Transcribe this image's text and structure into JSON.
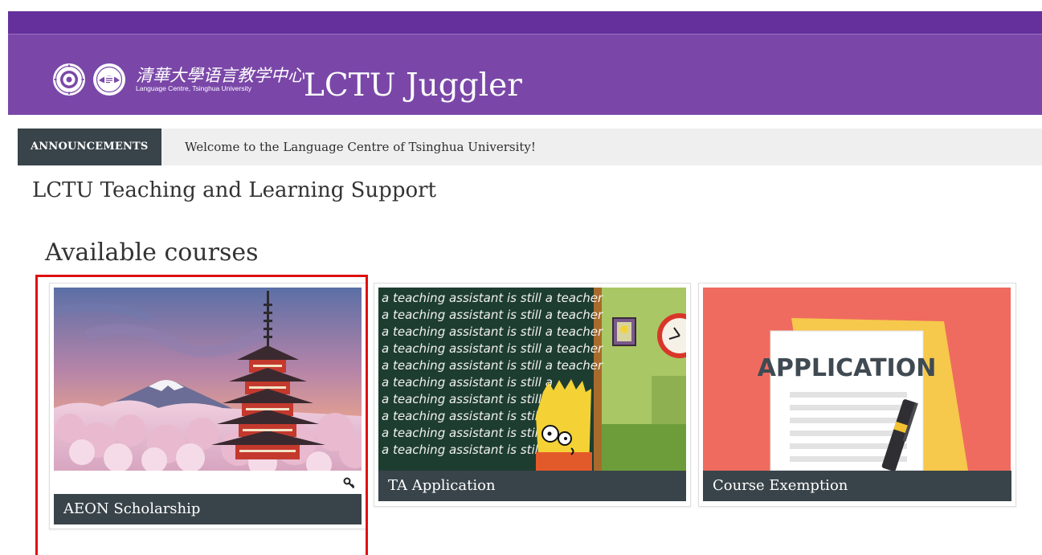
{
  "header": {
    "logo_cn": "清華大學语言教学中心",
    "logo_en": "Language Centre, Tsinghua University",
    "site_title": "LCTU Juggler",
    "colors": {
      "top": "#65309b",
      "main": "#7a47a8"
    }
  },
  "announcements": {
    "label": "ANNOUNCEMENTS",
    "text": "Welcome to the Language Centre of Tsinghua University!"
  },
  "page_title": "LCTU Teaching and Learning Support",
  "section_title": "Available courses",
  "courses": [
    {
      "title": "AEON Scholarship",
      "image": "pagoda-mount-fuji",
      "icon": "key-icon"
    },
    {
      "title": "TA Application",
      "image": "chalkboard-cartoon",
      "board_line": "a teaching assistant is still a teacher"
    },
    {
      "title": "Course Exemption",
      "image": "application-form",
      "image_text": "APPLICATION"
    }
  ],
  "colors": {
    "card_title_bg": "#39444a",
    "highlight": "#e01010"
  }
}
